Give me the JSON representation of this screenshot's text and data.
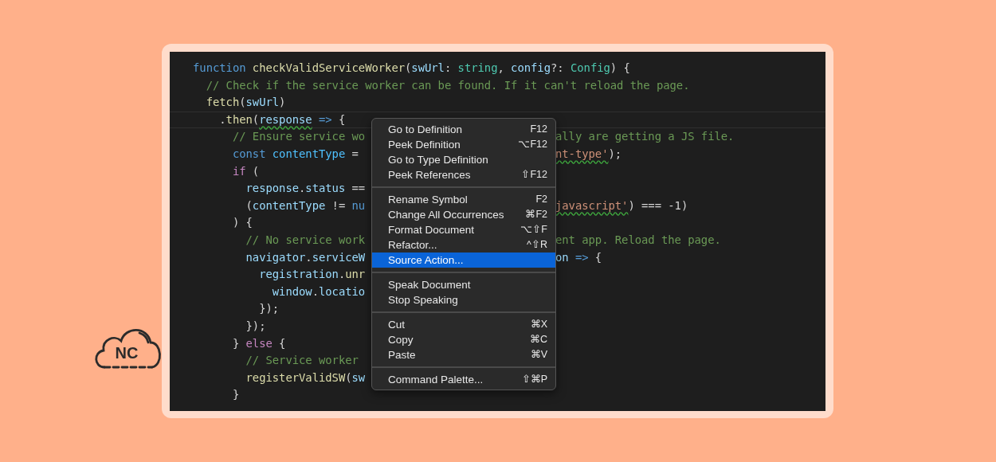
{
  "logo": {
    "text": "NC"
  },
  "editor": {
    "lines": [
      {
        "current": false,
        "left": [
          {
            "kind": "keyword",
            "text": "function"
          },
          {
            "kind": "function",
            "text": " checkValidServiceWorker"
          },
          {
            "kind": "plain",
            "text": "("
          },
          {
            "kind": "variable",
            "text": "swUrl"
          },
          {
            "kind": "plain",
            "text": ": "
          },
          {
            "kind": "type",
            "text": "string"
          },
          {
            "kind": "plain",
            "text": ", "
          },
          {
            "kind": "variable",
            "text": "config"
          },
          {
            "kind": "plain",
            "text": "?: "
          },
          {
            "kind": "type",
            "text": "Config"
          },
          {
            "kind": "plain",
            "text": ") {"
          }
        ]
      },
      {
        "current": false,
        "left": [
          {
            "kind": "comment",
            "text": "  // Check if the service worker can be found. If it can't reload the page."
          }
        ]
      },
      {
        "current": false,
        "left": [
          {
            "kind": "function",
            "text": "  fetch"
          },
          {
            "kind": "plain",
            "text": "("
          },
          {
            "kind": "variable",
            "text": "swUrl"
          },
          {
            "kind": "plain",
            "text": ")"
          }
        ]
      },
      {
        "current": true,
        "left": [
          {
            "kind": "plain",
            "text": "    ."
          },
          {
            "kind": "function",
            "text": "then"
          },
          {
            "kind": "plain",
            "text": "("
          },
          {
            "kind": "variable",
            "text": "response",
            "squiggle": true
          },
          {
            "kind": "keyword",
            "text": " =>"
          },
          {
            "kind": "plain",
            "text": " {"
          }
        ]
      },
      {
        "current": false,
        "left": [
          {
            "kind": "comment",
            "text": "      // Ensure service wo"
          }
        ],
        "right": [
          {
            "kind": "comment",
            "text": "ally are getting a JS file."
          }
        ]
      },
      {
        "current": false,
        "left": [
          {
            "kind": "keyword",
            "text": "      const"
          },
          {
            "kind": "constant",
            "text": " contentType"
          },
          {
            "kind": "plain",
            "text": " ="
          }
        ],
        "right": [
          {
            "kind": "string",
            "text": "nt-type'",
            "squiggle": true
          },
          {
            "kind": "plain",
            "text": ");"
          }
        ]
      },
      {
        "current": false,
        "left": [
          {
            "kind": "control",
            "text": "      if"
          },
          {
            "kind": "plain",
            "text": " ("
          }
        ]
      },
      {
        "current": false,
        "left": [
          {
            "kind": "variable",
            "text": "        response"
          },
          {
            "kind": "plain",
            "text": "."
          },
          {
            "kind": "variable",
            "text": "status"
          },
          {
            "kind": "plain",
            "text": " =="
          }
        ]
      },
      {
        "current": false,
        "left": [
          {
            "kind": "plain",
            "text": "        ("
          },
          {
            "kind": "variable",
            "text": "contentType"
          },
          {
            "kind": "plain",
            "text": " != "
          },
          {
            "kind": "keyword",
            "text": "nu"
          }
        ],
        "right": [
          {
            "kind": "string",
            "text": "javascript'",
            "squiggle": true
          },
          {
            "kind": "plain",
            "text": ") === -1)"
          }
        ]
      },
      {
        "current": false,
        "left": [
          {
            "kind": "plain",
            "text": "      ) {"
          }
        ]
      },
      {
        "current": false,
        "left": [
          {
            "kind": "comment",
            "text": "        // No service work"
          }
        ],
        "right": [
          {
            "kind": "comment",
            "text": "ent app. Reload the page."
          }
        ]
      },
      {
        "current": false,
        "left": [
          {
            "kind": "variable",
            "text": "        navigator"
          },
          {
            "kind": "plain",
            "text": "."
          },
          {
            "kind": "variable",
            "text": "serviceW"
          }
        ],
        "right": [
          {
            "kind": "variable",
            "text": "on"
          },
          {
            "kind": "keyword",
            "text": " =>"
          },
          {
            "kind": "plain",
            "text": " {"
          }
        ]
      },
      {
        "current": false,
        "left": [
          {
            "kind": "variable",
            "text": "          registration"
          },
          {
            "kind": "plain",
            "text": "."
          },
          {
            "kind": "function",
            "text": "unr"
          }
        ]
      },
      {
        "current": false,
        "left": [
          {
            "kind": "variable",
            "text": "            window"
          },
          {
            "kind": "plain",
            "text": "."
          },
          {
            "kind": "variable",
            "text": "locatio"
          }
        ]
      },
      {
        "current": false,
        "left": [
          {
            "kind": "plain",
            "text": "          });"
          }
        ]
      },
      {
        "current": false,
        "left": [
          {
            "kind": "plain",
            "text": "        });"
          }
        ]
      },
      {
        "current": false,
        "left": [
          {
            "kind": "plain",
            "text": "      } "
          },
          {
            "kind": "control",
            "text": "else"
          },
          {
            "kind": "plain",
            "text": " {"
          }
        ]
      },
      {
        "current": false,
        "left": [
          {
            "kind": "comment",
            "text": "        // Service worker"
          }
        ]
      },
      {
        "current": false,
        "left": [
          {
            "kind": "function",
            "text": "        registerValidSW"
          },
          {
            "kind": "plain",
            "text": "("
          },
          {
            "kind": "variable",
            "text": "sw"
          }
        ]
      },
      {
        "current": false,
        "left": [
          {
            "kind": "plain",
            "text": "      }"
          }
        ]
      }
    ]
  },
  "context_menu": {
    "groups": [
      [
        {
          "label": "Go to Definition",
          "shortcut": "F12",
          "selected": false
        },
        {
          "label": "Peek Definition",
          "shortcut": "⌥F12",
          "selected": false
        },
        {
          "label": "Go to Type Definition",
          "selected": false
        },
        {
          "label": "Peek References",
          "shortcut": "⇧F12",
          "selected": false
        }
      ],
      [
        {
          "label": "Rename Symbol",
          "shortcut": "F2",
          "selected": false
        },
        {
          "label": "Change All Occurrences",
          "shortcut": "⌘F2",
          "selected": false
        },
        {
          "label": "Format Document",
          "shortcut": "⌥⇧F",
          "selected": false
        },
        {
          "label": "Refactor...",
          "shortcut": "^⇧R",
          "selected": false
        },
        {
          "label": "Source Action...",
          "selected": true
        }
      ],
      [
        {
          "label": "Speak Document",
          "selected": false
        },
        {
          "label": "Stop Speaking",
          "selected": false
        }
      ],
      [
        {
          "label": "Cut",
          "shortcut": "⌘X",
          "selected": false
        },
        {
          "label": "Copy",
          "shortcut": "⌘C",
          "selected": false
        },
        {
          "label": "Paste",
          "shortcut": "⌘V",
          "selected": false
        }
      ],
      [
        {
          "label": "Command Palette...",
          "shortcut": "⇧⌘P",
          "selected": false
        }
      ]
    ]
  }
}
